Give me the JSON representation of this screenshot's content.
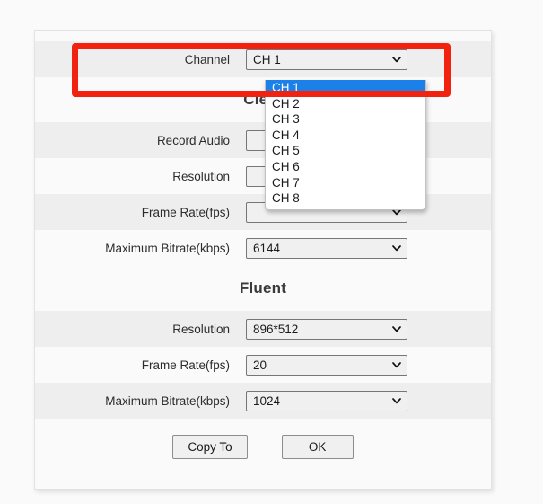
{
  "panel": {
    "sections": [
      {
        "heading": null,
        "rows": [
          {
            "label": "Channel",
            "control": "select",
            "value": "CH 1",
            "name": "channel"
          }
        ]
      },
      {
        "heading": "Clear",
        "rows": [
          {
            "label": "Record Audio",
            "control": "select",
            "value": "",
            "name": "record-audio"
          },
          {
            "label": "Resolution",
            "control": "select",
            "value": "",
            "name": "clear-resolution"
          },
          {
            "label": "Frame Rate(fps)",
            "control": "select",
            "value": "",
            "name": "clear-frame-rate"
          },
          {
            "label": "Maximum Bitrate(kbps)",
            "control": "select",
            "value": "6144",
            "name": "clear-max-bitrate"
          }
        ]
      },
      {
        "heading": "Fluent",
        "rows": [
          {
            "label": "Resolution",
            "control": "select",
            "value": "896*512",
            "name": "fluent-resolution"
          },
          {
            "label": "Frame Rate(fps)",
            "control": "select",
            "value": "20",
            "name": "fluent-frame-rate"
          },
          {
            "label": "Maximum Bitrate(kbps)",
            "control": "select",
            "value": "1024",
            "name": "fluent-max-bitrate"
          }
        ]
      }
    ],
    "buttons": [
      {
        "label": "Copy To",
        "name": "copy-to-button"
      },
      {
        "label": "OK",
        "name": "ok-button"
      }
    ]
  },
  "channel_dropdown": {
    "open": true,
    "selected": "CH 1",
    "options": [
      "CH 1",
      "CH 2",
      "CH 3",
      "CH 4",
      "CH 5",
      "CH 6",
      "CH 7",
      "CH 8"
    ]
  },
  "annotation": {
    "shape": "rectangle",
    "color": "#f22211",
    "target": "Channel"
  },
  "colors": {
    "highlight": "#1b80e8",
    "annotation": "#f22211",
    "row_shade": "#eeeeee",
    "row_plain": "#fafafa",
    "panel_bg": "#fafafa",
    "control_bg": "#f0f0f0",
    "control_border": "#767676"
  },
  "labels": {
    "channel": "Channel",
    "clear_heading": "Clear",
    "fluent_heading": "Fluent",
    "record_audio": "Record Audio",
    "resolution": "Resolution",
    "frame_rate": "Frame Rate(fps)",
    "max_bitrate": "Maximum Bitrate(kbps)",
    "copy_to": "Copy To",
    "ok": "OK"
  },
  "values": {
    "channel": "CH 1",
    "clear_max_bitrate": "6144",
    "fluent_resolution": "896*512",
    "fluent_frame_rate": "20",
    "fluent_max_bitrate": "1024"
  }
}
